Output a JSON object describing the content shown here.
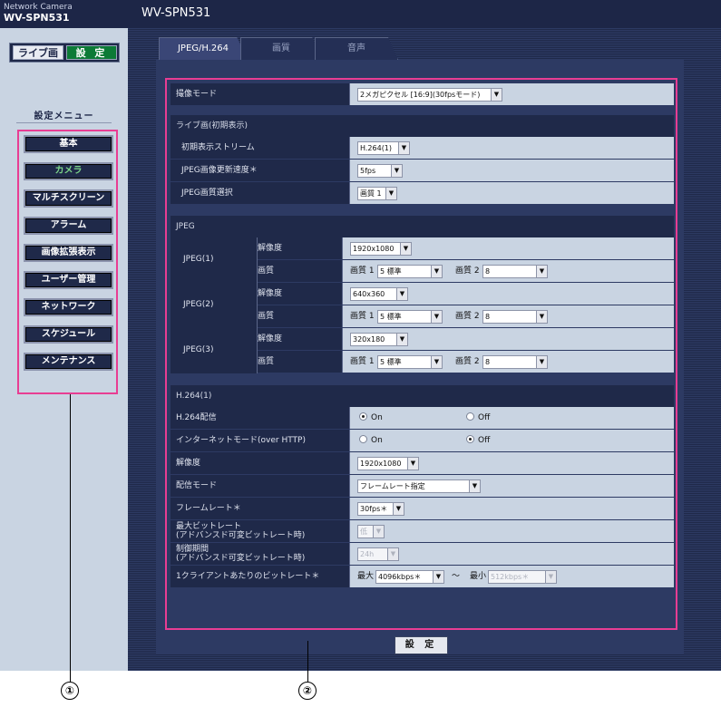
{
  "header": {
    "brand_line1": "Network Camera",
    "brand_line2": "WV-SPN531",
    "title": "WV-SPN531"
  },
  "mode": {
    "live": "ライブ画",
    "setting": "設 定"
  },
  "menu": {
    "title": "設定メニュー",
    "items": [
      "基本",
      "カメラ",
      "マルチスクリーン",
      "アラーム",
      "画像拡張表示",
      "ユーザー管理",
      "ネットワーク",
      "スケジュール",
      "メンテナンス"
    ],
    "active_index": 1
  },
  "tabs": [
    "JPEG/H.264",
    "画質",
    "音声"
  ],
  "form": {
    "capture_mode": {
      "label": "撮像モード",
      "value": "2メガピクセル [16:9](30fpsモード)"
    },
    "live_section": "ライブ画(初期表示)",
    "initial_stream": {
      "label": "初期表示ストリーム",
      "value": "H.264(1)"
    },
    "jpeg_refresh": {
      "label": "JPEG画像更新速度＊",
      "value": "5fps"
    },
    "jpeg_quality_select": {
      "label": "JPEG画質選択",
      "value": "画質 1"
    },
    "jpeg_section": "JPEG",
    "jpeg_groups": [
      {
        "name": "JPEG(1)",
        "resolution_label": "解像度",
        "resolution": "1920x1080",
        "quality_label": "画質",
        "q1_label": "画質 1",
        "q1": "5 標準",
        "q2_label": "画質 2",
        "q2": "8"
      },
      {
        "name": "JPEG(2)",
        "resolution_label": "解像度",
        "resolution": "640x360",
        "quality_label": "画質",
        "q1_label": "画質 1",
        "q1": "5 標準",
        "q2_label": "画質 2",
        "q2": "8"
      },
      {
        "name": "JPEG(3)",
        "resolution_label": "解像度",
        "resolution": "320x180",
        "quality_label": "画質",
        "q1_label": "画質 1",
        "q1": "5 標準",
        "q2_label": "画質 2",
        "q2": "8"
      }
    ],
    "h264_section": "H.264(1)",
    "h264_delivery": {
      "label": "H.264配信",
      "on": "On",
      "off": "Off",
      "selected": "On"
    },
    "internet_mode": {
      "label": "インターネットモード(over HTTP)",
      "on": "On",
      "off": "Off",
      "selected": "Off"
    },
    "resolution": {
      "label": "解像度",
      "value": "1920x1080"
    },
    "delivery_mode": {
      "label": "配信モード",
      "value": "フレームレート指定"
    },
    "frame_rate": {
      "label": "フレームレート＊",
      "value": "30fps＊"
    },
    "max_bitrate": {
      "label1": "最大ビットレート",
      "label2": "(アドバンスド可変ビットレート時)",
      "value": "低"
    },
    "control_period": {
      "label1": "制御期間",
      "label2": "(アドバンスド可変ビットレート時)",
      "value": "24h"
    },
    "client_bitrate": {
      "label": "1クライアントあたりのビットレート＊",
      "max_label": "最大",
      "max": "4096kbps＊",
      "tilde": "〜",
      "min_label": "最小",
      "min": "512kbps＊"
    }
  },
  "submit": "設 定",
  "callouts": [
    "①",
    "②"
  ]
}
